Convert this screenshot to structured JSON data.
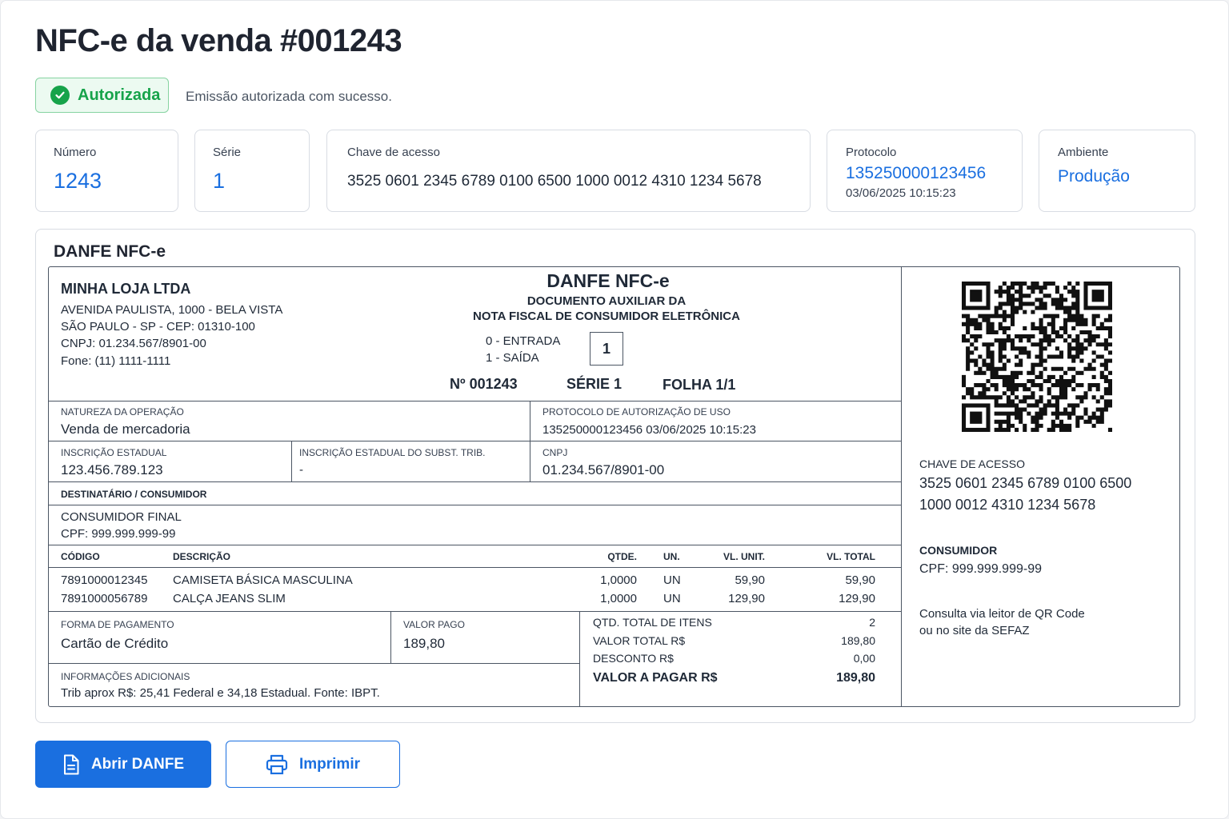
{
  "header": {
    "title": "NFC-e da venda #001243",
    "status_label": "Autorizada",
    "status_message": "Emissão autorizada com sucesso."
  },
  "cards": {
    "numero": {
      "label": "Número",
      "value": "1243"
    },
    "serie": {
      "label": "Série",
      "value": "1"
    },
    "chave": {
      "label": "Chave de acesso",
      "value": "3525 0601 2345 6789 0100 6500 1000 0012 4310 1234 5678"
    },
    "protocolo": {
      "label": "Protocolo",
      "value": "135250000123456",
      "datetime": "03/06/2025 10:15:23"
    },
    "ambiente": {
      "label": "Ambiente",
      "value": "Produção"
    }
  },
  "panel": {
    "title": "DANFE NFC-e"
  },
  "danfe": {
    "emitente": {
      "name": "MINHA LOJA LTDA",
      "address1": "AVENIDA PAULISTA, 1000 - BELA VISTA",
      "address2": "SÃO PAULO - SP - CEP: 01310-100",
      "cnpj": "CNPJ: 01.234.567/8901-00",
      "phone": "Fone: (11) 1111-1111"
    },
    "doc": {
      "title": "DANFE NFC-e",
      "subtitle1": "DOCUMENTO AUXILIAR DA",
      "subtitle2": "NOTA FISCAL DE CONSUMIDOR ELETRÔNICA",
      "entrada": "0 - ENTRADA",
      "saida": "1 - SAÍDA",
      "tipo": "1",
      "numero": "Nº 001243",
      "serie": "SÉRIE 1",
      "folha": "FOLHA 1/1"
    },
    "natureza": {
      "label": "NATUREZA DA OPERAÇÃO",
      "value": "Venda de mercadoria"
    },
    "protocolo": {
      "label": "PROTOCOLO DE AUTORIZAÇÃO DE USO",
      "value": "135250000123456 03/06/2025 10:15:23"
    },
    "ie": {
      "label": "INSCRIÇÃO ESTADUAL",
      "value": "123.456.789.123"
    },
    "ie_st": {
      "label": "INSCRIÇÃO ESTADUAL DO SUBST. TRIB.",
      "value": "-"
    },
    "cnpj": {
      "label": "CNPJ",
      "value": "01.234.567/8901-00"
    },
    "destinatario": {
      "label": "DESTINATÁRIO / CONSUMIDOR",
      "name": "CONSUMIDOR FINAL",
      "cpf": "CPF: 999.999.999-99"
    },
    "items_header": {
      "codigo": "CÓDIGO",
      "descricao": "DESCRIÇÃO",
      "qtde": "QTDE.",
      "un": "UN.",
      "vl_unit": "VL. UNIT.",
      "vl_total": "VL. TOTAL"
    },
    "items": [
      {
        "codigo": "7891000012345",
        "descricao": "CAMISETA BÁSICA MASCULINA",
        "qtde": "1,0000",
        "un": "UN",
        "vl_unit": "59,90",
        "vl_total": "59,90"
      },
      {
        "codigo": "7891000056789",
        "descricao": "CALÇA JEANS SLIM",
        "qtde": "1,0000",
        "un": "UN",
        "vl_unit": "129,90",
        "vl_total": "129,90"
      }
    ],
    "pagamento": {
      "label": "FORMA DE PAGAMENTO",
      "value": "Cartão de Crédito"
    },
    "valor_pago": {
      "label": "VALOR PAGO",
      "value": "189,80"
    },
    "totais": {
      "qtd_label": "QTD. TOTAL DE ITENS",
      "qtd_value": "2",
      "total_label": "VALOR TOTAL R$",
      "total_value": "189,80",
      "desconto_label": "DESCONTO R$",
      "desconto_value": "0,00",
      "pagar_label": "VALOR A PAGAR R$",
      "pagar_value": "189,80"
    },
    "info": {
      "label": "INFORMAÇÕES ADICIONAIS",
      "value": "Trib aprox R$: 25,41 Federal e 34,18 Estadual. Fonte: IBPT."
    },
    "side": {
      "chave_label": "CHAVE DE ACESSO",
      "chave_line1": "3525 0601 2345 6789 0100 6500",
      "chave_line2": "1000 0012 4310 1234 5678",
      "consumidor_label": "CONSUMIDOR",
      "consumidor_cpf": "CPF: 999.999.999-99",
      "consulta_line1": "Consulta via leitor de QR Code",
      "consulta_line2": "ou no site da SEFAZ"
    }
  },
  "actions": {
    "open_label": "Abrir DANFE",
    "print_label": "Imprimir"
  },
  "colors": {
    "primary": "#1a6fe0",
    "success": "#16a34a",
    "success_bg": "#ecfaf1",
    "border": "#d8dce3"
  }
}
